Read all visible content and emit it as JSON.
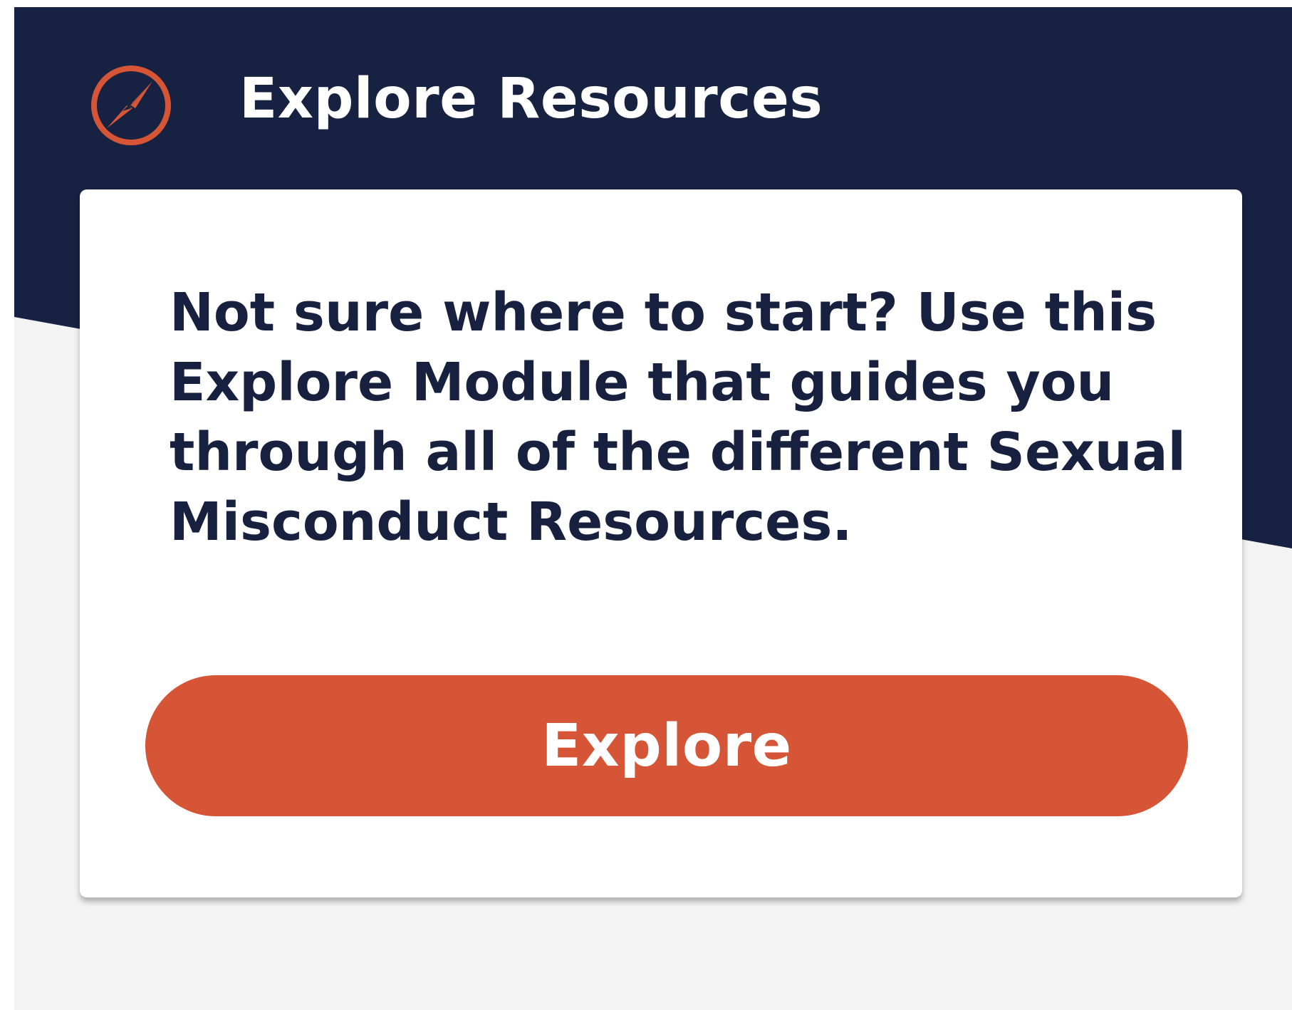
{
  "header": {
    "title": "Explore Resources",
    "icon": "compass-icon"
  },
  "card": {
    "message": "Not sure where to start? Use this Explore Module that guides you through all of the different Sexual Misconduct Resources.",
    "button_label": "Explore"
  },
  "colors": {
    "header_background": "#172141",
    "page_background": "#f3f3f3",
    "card_background": "#ffffff",
    "accent": "#d65536",
    "body_text": "#17213f"
  }
}
